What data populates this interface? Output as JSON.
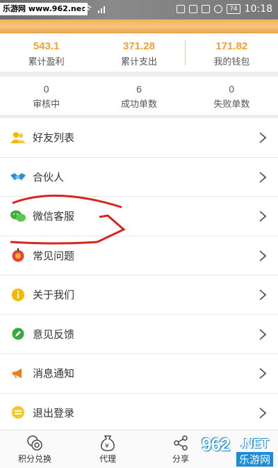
{
  "status_bar": {
    "watermark": "乐游网 www.962.net",
    "battery": "74",
    "time": "10:18"
  },
  "stats_top": [
    {
      "value": "543.1",
      "label": "累计盈利"
    },
    {
      "value": "371.28",
      "label": "累计支出"
    },
    {
      "value": "171.82",
      "label": "我的钱包"
    }
  ],
  "stats_bottom": [
    {
      "value": "0",
      "label": "审核中"
    },
    {
      "value": "6",
      "label": "成功单数"
    },
    {
      "value": "0",
      "label": "失败单数"
    }
  ],
  "menu": [
    {
      "label": "好友列表",
      "icon": "friends-icon"
    },
    {
      "label": "合伙人",
      "icon": "handshake-icon"
    },
    {
      "label": "微信客服",
      "icon": "wechat-icon"
    },
    {
      "label": "常见问题",
      "icon": "question-icon"
    },
    {
      "label": "关于我们",
      "icon": "info-icon"
    },
    {
      "label": "意见反馈",
      "icon": "feedback-icon"
    },
    {
      "label": "消息通知",
      "icon": "megaphone-icon"
    },
    {
      "label": "退出登录",
      "icon": "logout-icon"
    }
  ],
  "bottom_nav": [
    {
      "label": "积分兑换",
      "icon": "coins-icon"
    },
    {
      "label": "代理",
      "icon": "money-bag-icon"
    },
    {
      "label": "分享",
      "icon": "share-icon"
    }
  ],
  "logo": {
    "num": "962",
    "net": ".NET",
    "cn": "乐游网"
  },
  "colors": {
    "accent": "#f0a32a",
    "annotation": "#d9231f"
  }
}
